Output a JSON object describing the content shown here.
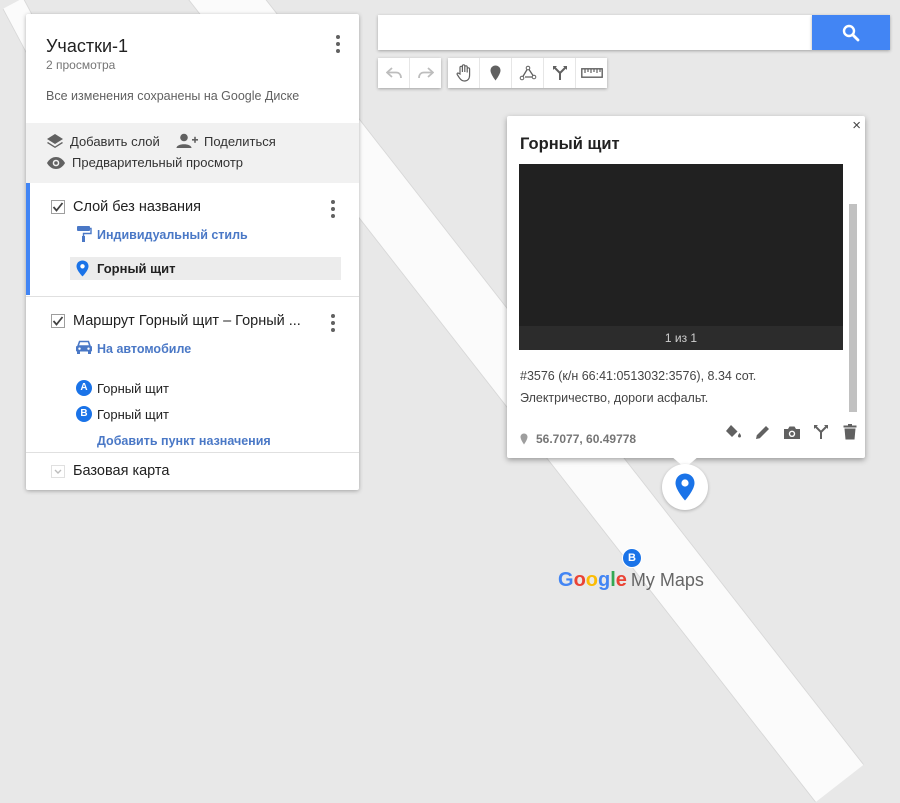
{
  "panel": {
    "map_title": "Участки-1",
    "views": "2 просмотра",
    "saved": "Все изменения сохранены на Google Диске",
    "add_layer": "Добавить слой",
    "share": "Поделиться",
    "preview": "Предварительный просмотр"
  },
  "layer1": {
    "name": "Слой без названия",
    "style": "Индивидуальный стиль",
    "item": "Горный щит"
  },
  "route": {
    "name": "Маршрут Горный щит – Горный ...",
    "mode": "На автомобиле",
    "stops": [
      {
        "badge": "A",
        "label": "Горный щит"
      },
      {
        "badge": "B",
        "label": "Горный щит"
      }
    ],
    "add_destination": "Добавить пункт назначения"
  },
  "base_map": "Базовая карта",
  "search": {
    "value": "",
    "placeholder": ""
  },
  "toolbar_icons": [
    "undo-icon",
    "redo-icon",
    "hand-icon",
    "marker-icon",
    "draw-line-icon",
    "directions-icon",
    "ruler-icon"
  ],
  "card": {
    "close": "×",
    "title": "Горный щит",
    "photo_counter": "1 из 1",
    "description_line1": "#3576 (к/н 66:41:0513032:3576), 8.34 сот.",
    "description_line2": "Электричество, дороги асфальт.",
    "coordinates": "56.7077, 60.49778"
  },
  "map": {
    "marker_b": "B",
    "logo_google": "Google",
    "logo_product": "My Maps"
  },
  "colors": {
    "accent": "#4285f4",
    "link": "#4a78c6",
    "badge": "#1a73e8",
    "marker": "#1a73e8"
  }
}
